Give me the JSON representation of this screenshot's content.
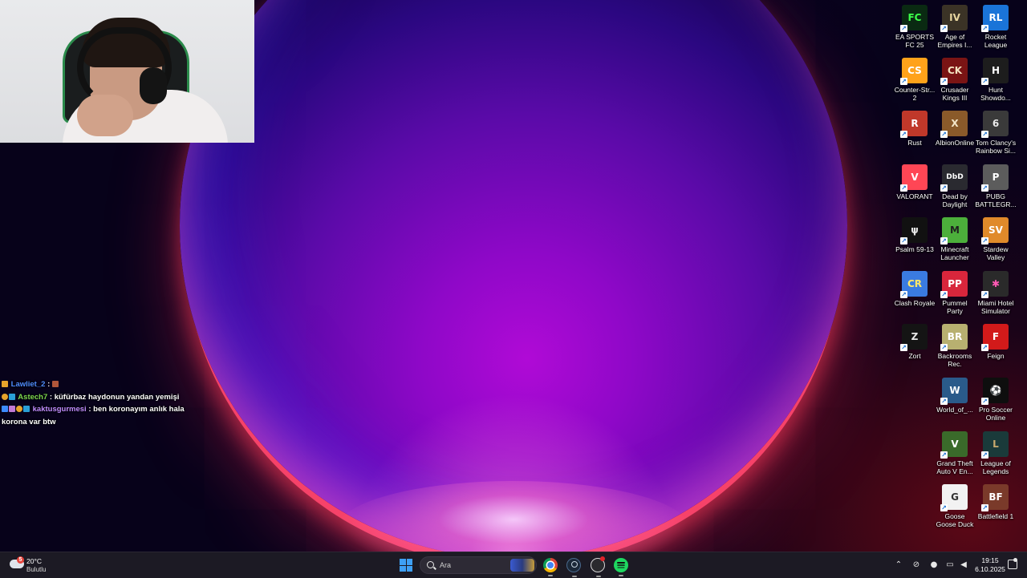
{
  "webcam": {
    "description": "streamer webcam overlay"
  },
  "chat": {
    "messages": [
      {
        "user": "Lawliet_2",
        "separator": ":",
        "text": "",
        "user_color": "#4f8cff",
        "badges": [
          "#e6a42b"
        ],
        "trail": "#b0563a"
      },
      {
        "user": "Astech7",
        "separator": ":",
        "text": "küfürbaz haydonun yandan yemişi",
        "user_color": "#7dd64f",
        "badges": [
          "#e6a42b",
          "#2a9fd6"
        ]
      },
      {
        "user": "kaktusgurmesi",
        "separator": ":",
        "text": "ben koronayım anlık hala korona var btw",
        "user_color": "#c08cff",
        "badges": [
          "#3d8bff",
          "#c27ad6",
          "#e6a42b",
          "#2a9fd6"
        ]
      }
    ]
  },
  "desktop_icons": [
    {
      "label": "EA SPORTS FC 25",
      "glyph": "FC",
      "bg": "#0a2a12",
      "fg": "#3cff4a"
    },
    {
      "label": "Age of Empires I...",
      "glyph": "IV",
      "bg": "#3b3326",
      "fg": "#e8d6a0"
    },
    {
      "label": "Rocket League",
      "glyph": "RL",
      "bg": "#1a74d8",
      "fg": "#ffffff"
    },
    {
      "label": "Counter-Str... 2",
      "glyph": "CS",
      "bg": "#ffa21a",
      "fg": "#ffffff"
    },
    {
      "label": "Crusader Kings III",
      "glyph": "CK",
      "bg": "#7a1414",
      "fg": "#f3e3c0"
    },
    {
      "label": "Hunt Showdo...",
      "glyph": "H",
      "bg": "#1d1d1d",
      "fg": "#ffffff"
    },
    {
      "label": "Rust",
      "glyph": "R",
      "bg": "#c0382a",
      "fg": "#ffffff"
    },
    {
      "label": "AlbionOnline",
      "glyph": "X",
      "bg": "#8a5a2a",
      "fg": "#f3e6c8"
    },
    {
      "label": "Tom Clancy's Rainbow Si...",
      "glyph": "6",
      "bg": "#3a3a3a",
      "fg": "#e9e9e9"
    },
    {
      "label": "VALORANT",
      "glyph": "V",
      "bg": "#ff4655",
      "fg": "#ffffff"
    },
    {
      "label": "Dead by Daylight",
      "glyph": "DbD",
      "bg": "#2a2a30",
      "fg": "#ffffff"
    },
    {
      "label": "PUBG BATTLEGR...",
      "glyph": "P",
      "bg": "#5c5c5c",
      "fg": "#ffffff"
    },
    {
      "label": "Psalm 59-13",
      "glyph": "ψ",
      "bg": "#111111",
      "fg": "#e6e6e6"
    },
    {
      "label": "Minecraft Launcher",
      "glyph": "M",
      "bg": "#4caf3b",
      "fg": "#1f1f1f"
    },
    {
      "label": "Stardew Valley",
      "glyph": "SV",
      "bg": "#e08a2a",
      "fg": "#ffffff"
    },
    {
      "label": "Clash Royale",
      "glyph": "CR",
      "bg": "#3a7be0",
      "fg": "#ffe76a"
    },
    {
      "label": "Pummel Party",
      "glyph": "PP",
      "bg": "#d8263c",
      "fg": "#ffffff"
    },
    {
      "label": "Miami Hotel Simulator",
      "glyph": "✱",
      "bg": "#2a2a2a",
      "fg": "#ff5ab4"
    },
    {
      "label": "Zort",
      "glyph": "Z",
      "bg": "#141414",
      "fg": "#e6e6e6"
    },
    {
      "label": "Backrooms Rec.",
      "glyph": "BR",
      "bg": "#b8b070",
      "fg": "#ffffff"
    },
    {
      "label": "Feign",
      "glyph": "F",
      "bg": "#d21a1a",
      "fg": "#ffffff"
    },
    {
      "label": "World_of_...",
      "glyph": "W",
      "bg": "#2a5a8a",
      "fg": "#ffffff"
    },
    {
      "label": "Pro Soccer Online",
      "glyph": "⚽",
      "bg": "#0e0e0e",
      "fg": "#ffffff"
    },
    {
      "label": "Grand Theft Auto V En...",
      "glyph": "V",
      "bg": "#3a6a2a",
      "fg": "#ffffff"
    },
    {
      "label": "League of Legends",
      "glyph": "L",
      "bg": "#1a3a3a",
      "fg": "#c8aa6e"
    },
    {
      "label": "Goose Goose Duck",
      "glyph": "G",
      "bg": "#f2f2f2",
      "fg": "#333333"
    },
    {
      "label": "Battlefield 1",
      "glyph": "BF",
      "bg": "#7a3a2a",
      "fg": "#ffffff"
    }
  ],
  "taskbar": {
    "weather": {
      "temp": "20°C",
      "condition": "Bulutlu",
      "alert_count": "5"
    },
    "search_placeholder": "Ara",
    "apps": [
      "chrome-icon",
      "steam-icon",
      "obs-icon",
      "spotify-icon"
    ],
    "tray_icons": [
      "chevron-up-icon",
      "network-off-icon",
      "microphone-icon",
      "display-icon",
      "volume-icon"
    ],
    "time": "19:15",
    "date": "6.10.2025"
  }
}
